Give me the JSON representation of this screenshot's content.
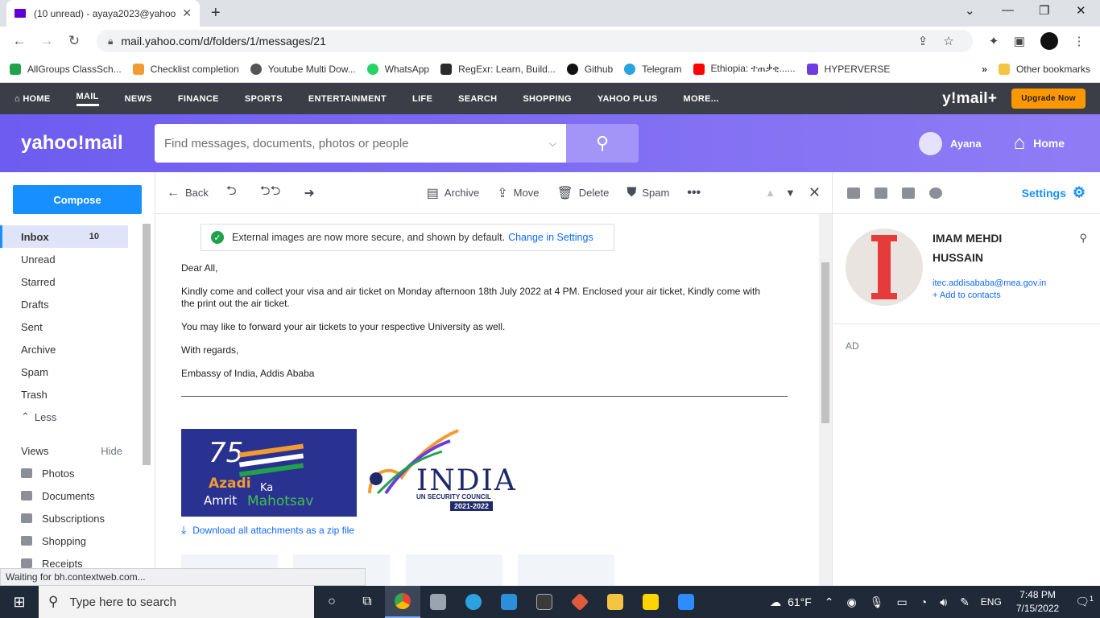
{
  "browser": {
    "tab_title": "(10 unread) - ayaya2023@yahoo",
    "url": "mail.yahoo.com/d/folders/1/messages/21",
    "bookmarks": [
      {
        "label": "AllGroups ClassSch...",
        "color": "#1ea34a"
      },
      {
        "label": "Checklist completion",
        "color": "#f29b30"
      },
      {
        "label": "Youtube Multi Dow...",
        "color": "#555555"
      },
      {
        "label": "WhatsApp",
        "color": "#25d366"
      },
      {
        "label": "RegExr: Learn, Build...",
        "color": "#2b2b2b"
      },
      {
        "label": "Github",
        "color": "#111111"
      },
      {
        "label": "Telegram",
        "color": "#2aa3df"
      },
      {
        "label": "Ethiopia: ተጠቃቂ......",
        "color": "#ff0000"
      },
      {
        "label": "HYPERVERSE",
        "color": "#6c3ce0"
      }
    ],
    "bookmarks_more": "»",
    "other_bookmarks": "Other bookmarks"
  },
  "ynav": {
    "items": [
      "HOME",
      "MAIL",
      "NEWS",
      "FINANCE",
      "SPORTS",
      "ENTERTAINMENT",
      "LIFE",
      "SEARCH",
      "SHOPPING",
      "YAHOO PLUS",
      "MORE..."
    ],
    "active": "MAIL",
    "brand": "y!mail+",
    "upgrade": "Upgrade Now"
  },
  "header": {
    "logo": "yahoo!mail",
    "search_placeholder": "Find messages, documents, photos or people",
    "user": "Ayana",
    "home": "Home"
  },
  "leftnav": {
    "compose": "Compose",
    "folders": [
      {
        "label": "Inbox",
        "count": "10"
      },
      {
        "label": "Unread"
      },
      {
        "label": "Starred"
      },
      {
        "label": "Drafts"
      },
      {
        "label": "Sent"
      },
      {
        "label": "Archive"
      },
      {
        "label": "Spam"
      },
      {
        "label": "Trash"
      }
    ],
    "less": "Less",
    "views_label": "Views",
    "hide": "Hide",
    "views": [
      "Photos",
      "Documents",
      "Subscriptions",
      "Shopping",
      "Receipts"
    ]
  },
  "toolbar": {
    "back": "Back",
    "archive": "Archive",
    "move": "Move",
    "delete": "Delete",
    "spam": "Spam"
  },
  "message": {
    "notice_text": "External images are now more secure, and shown by default.",
    "notice_link": "Change in Settings",
    "greeting": "Dear All,",
    "para1": "Kindly come and collect your visa and air ticket on Monday afternoon 18th July 2022  at 4 PM. Enclosed your air ticket, Kindly come with the print out the air ticket.",
    "para2": "You may like to forward your air tickets to your respective University as well.",
    "regards": "With regards,",
    "signature": "Embassy of India, Addis Ababa",
    "azadi_num": "75",
    "azadi_line1": "Azadi",
    "azadi_ka": "Ka",
    "azadi_line2": "Amrit",
    "azadi_line3": "Mahotsav",
    "india_title": "INDIA",
    "india_sub": "UN SECURITY COUNCIL",
    "india_years": "2021-2022",
    "download": "Download all attachments as a zip file"
  },
  "rightpane": {
    "settings": "Settings",
    "contact_name": "IMAM MEHDI HUSSAIN",
    "contact_email": "itec.addisababa@mea.gov.in",
    "add_contact": "+ Add to contacts",
    "ad": "AD"
  },
  "status_bubble": "Waiting for bh.contextweb.com...",
  "taskbar": {
    "search": "Type here to search",
    "weather": "61°F",
    "lang": "ENG",
    "time": "7:48 PM",
    "date": "7/15/2022",
    "notif_count": "1"
  }
}
